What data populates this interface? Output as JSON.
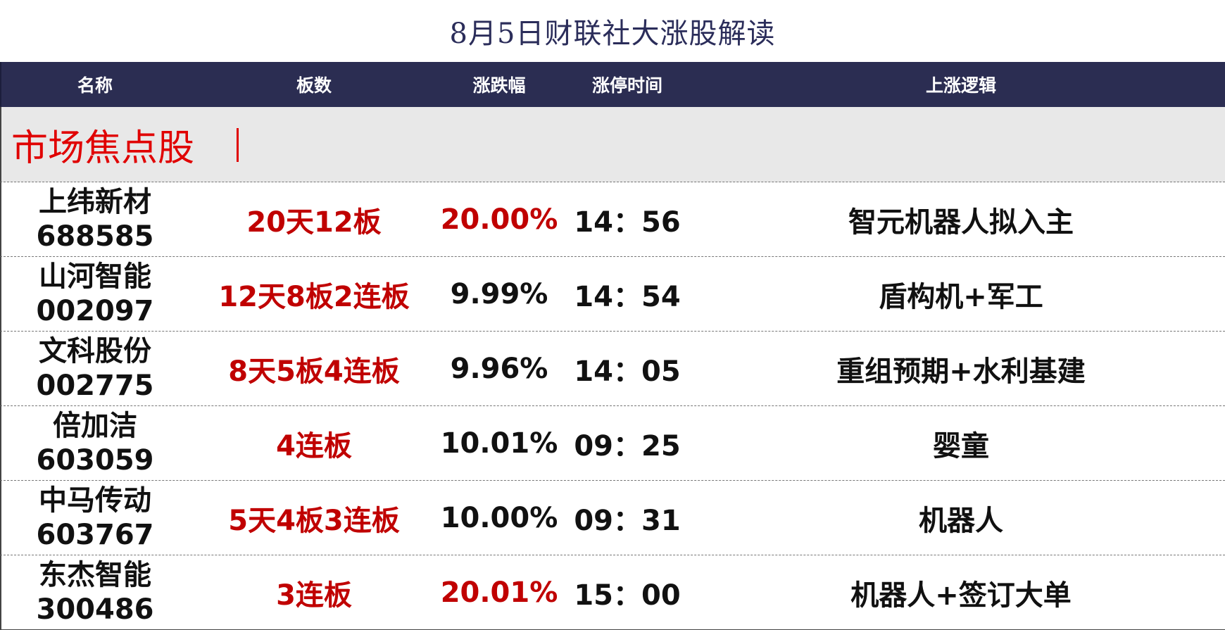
{
  "title": "8月5日财联社大涨股解读",
  "columns": [
    "名称",
    "板数",
    "涨跌幅",
    "涨停时间",
    "上涨逻辑"
  ],
  "section": {
    "label": "市场焦点股",
    "bar": "｜"
  },
  "colors": {
    "header_bg": "#2b2d52",
    "accent_red": "#c00000",
    "section_red": "#e00000",
    "section_bg": "#e8e8e8"
  },
  "rows": [
    {
      "name": "上纬新材",
      "code": "688585",
      "board": "20天12板",
      "change": "20.00%",
      "change_color": "red",
      "time": "14：56",
      "logic": "智元机器人拟入主"
    },
    {
      "name": "山河智能",
      "code": "002097",
      "board": "12天8板2连板",
      "change": "9.99%",
      "change_color": "black",
      "time": "14：54",
      "logic": "盾构机+军工"
    },
    {
      "name": "文科股份",
      "code": "002775",
      "board": "8天5板4连板",
      "change": "9.96%",
      "change_color": "black",
      "time": "14：05",
      "logic": "重组预期+水利基建"
    },
    {
      "name": "倍加洁",
      "code": "603059",
      "board": "4连板",
      "change": "10.01%",
      "change_color": "black",
      "time": "09：25",
      "logic": "婴童"
    },
    {
      "name": "中马传动",
      "code": "603767",
      "board": "5天4板3连板",
      "change": "10.00%",
      "change_color": "black",
      "time": "09：31",
      "logic": "机器人"
    },
    {
      "name": "东杰智能",
      "code": "300486",
      "board": "3连板",
      "change": "20.01%",
      "change_color": "red",
      "time": "15：00",
      "logic": "机器人+签订大单"
    }
  ]
}
